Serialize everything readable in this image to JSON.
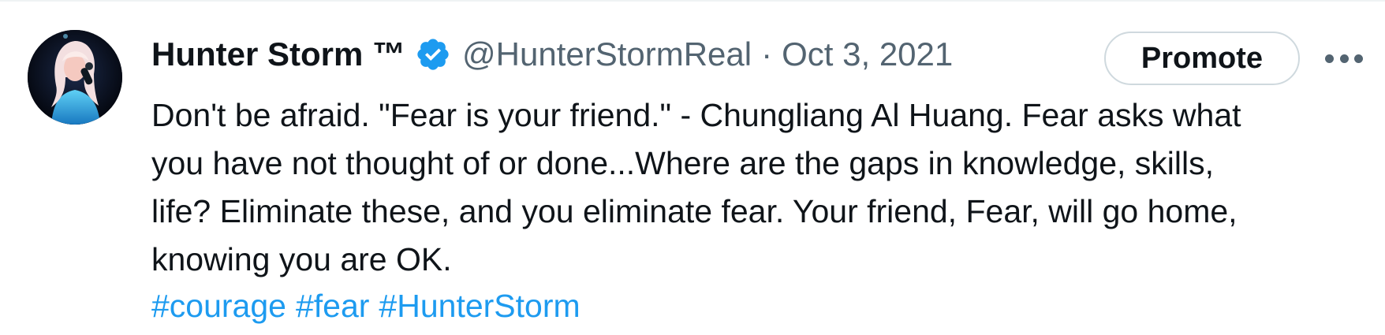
{
  "tweet": {
    "author_name": "Hunter Storm ™",
    "handle": "@HunterStormReal",
    "separator": "·",
    "date": "Oct 3, 2021",
    "promote_label": "Promote",
    "text_lines": [
      "Don't be afraid. \"Fear is your friend.\" - Chungliang Al Huang. Fear asks what",
      "you have not thought of or done...Where are the gaps in knowledge, skills,",
      "life? Eliminate these, and you eliminate fear. Your friend, Fear, will go home,",
      "knowing you are OK."
    ],
    "hashtags": [
      "#courage",
      "#fear",
      "#HunterStorm"
    ]
  },
  "icons": {
    "verified": "verified-badge-icon",
    "more": "more-options-icon"
  },
  "colors": {
    "text": "#0f1419",
    "secondary": "#536471",
    "accent": "#1d9bf0",
    "border": "#cfd9de"
  }
}
